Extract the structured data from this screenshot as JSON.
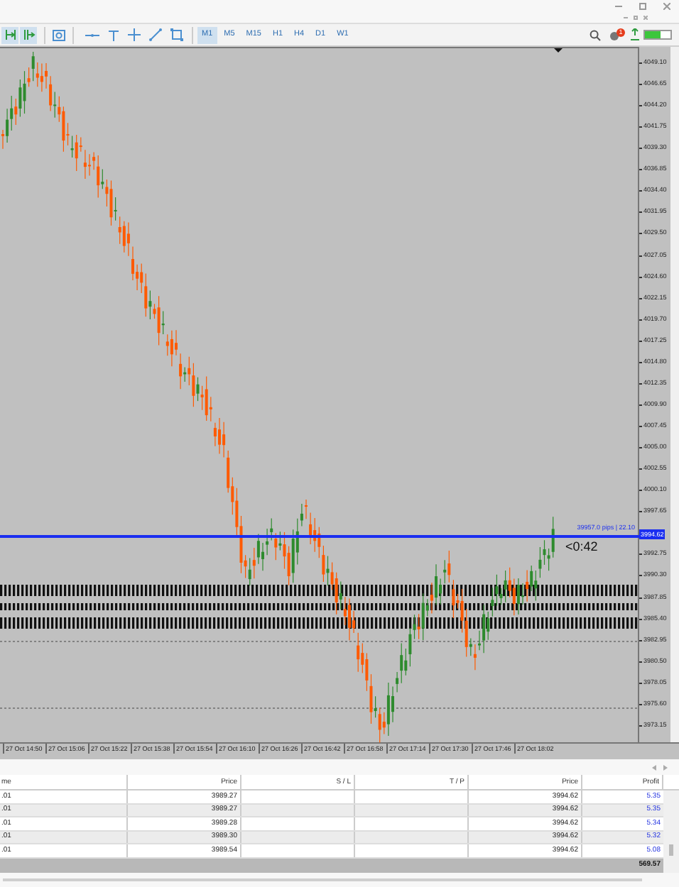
{
  "toolbar": {
    "timeframes": [
      {
        "label": "M1",
        "selected": true
      },
      {
        "label": "M5",
        "selected": false
      },
      {
        "label": "M15",
        "selected": false
      },
      {
        "label": "H1",
        "selected": false
      },
      {
        "label": "H4",
        "selected": false
      },
      {
        "label": "D1",
        "selected": false
      },
      {
        "label": "W1",
        "selected": false
      }
    ],
    "notification_badge": "1",
    "connection": {
      "level": 0.6
    }
  },
  "chart": {
    "price_labels": [
      "4049.10",
      "4046.65",
      "4044.20",
      "4041.75",
      "4039.30",
      "4036.85",
      "4034.40",
      "4031.95",
      "4029.50",
      "4027.05",
      "4024.60",
      "4022.15",
      "4019.70",
      "4017.25",
      "4014.80",
      "4012.35",
      "4009.90",
      "4007.45",
      "4005.00",
      "4002.55",
      "4000.10",
      "3997.65",
      "3992.75",
      "3990.30",
      "3987.85",
      "3985.40",
      "3982.95",
      "3980.50",
      "3978.05",
      "3975.60",
      "3973.15"
    ],
    "current_price": "3994.62",
    "line_label": "39957.0 pips | 22.10",
    "countdown": "<0:42",
    "time_labels": [
      "27 Oct 14:50",
      "27 Oct 15:06",
      "27 Oct 15:22",
      "27 Oct 15:38",
      "27 Oct 15:54",
      "27 Oct 16:10",
      "27 Oct 16:26",
      "27 Oct 16:42",
      "27 Oct 16:58",
      "27 Oct 17:14",
      "27 Oct 17:30",
      "27 Oct 17:46",
      "27 Oct 18:02"
    ]
  },
  "trades": {
    "columns": [
      "me",
      "Price",
      "S / L",
      "T / P",
      "Price",
      "Profit"
    ],
    "rows": [
      {
        "column_1": ".01",
        "price": "3989.27",
        "current_price": "3994.62",
        "profit": "5.35"
      },
      {
        "column_1": ".01",
        "price": "3989.27",
        "current_price": "3994.62",
        "profit": "5.35"
      },
      {
        "column_1": ".01",
        "price": "3989.28",
        "current_price": "3994.62",
        "profit": "5.34"
      },
      {
        "column_1": ".01",
        "price": "3989.30",
        "current_price": "3994.62",
        "profit": "5.32"
      },
      {
        "column_1": ".01",
        "price": "3989.54",
        "current_price": "3994.62",
        "profit": "5.08"
      }
    ],
    "total": "569.57"
  }
}
